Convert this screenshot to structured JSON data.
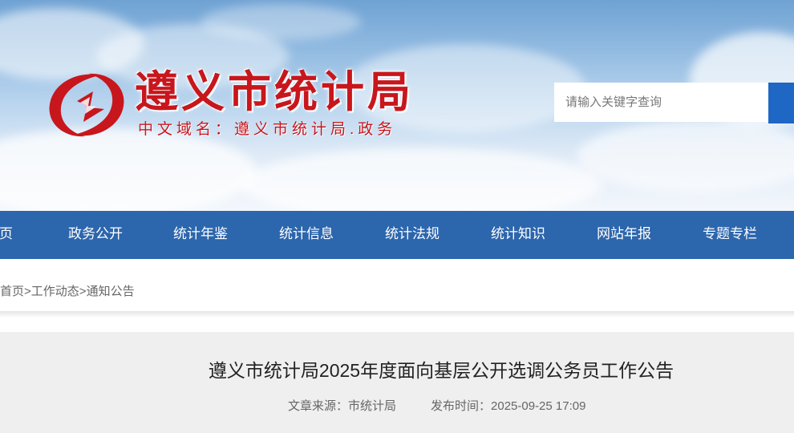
{
  "header": {
    "site_title": "遵义市统计局",
    "domain_line": "中文域名：遵义市统计局.政务",
    "search": {
      "placeholder": "请输入关键字查询"
    }
  },
  "nav": {
    "items": [
      {
        "label": "首页"
      },
      {
        "label": "政务公开"
      },
      {
        "label": "统计年鉴"
      },
      {
        "label": "统计信息"
      },
      {
        "label": "统计法规"
      },
      {
        "label": "统计知识"
      },
      {
        "label": "网站年报"
      },
      {
        "label": "专题专栏"
      }
    ]
  },
  "breadcrumb": {
    "items": [
      "首页",
      "工作动态",
      "通知公告"
    ],
    "separator": ">"
  },
  "article": {
    "title": "遵义市统计局2025年度面向基层公开选调公务员工作公告",
    "source_label": "文章来源：",
    "source_value": "市统计局",
    "time_label": "发布时间：",
    "time_value": "2025-09-25 17:09"
  },
  "colors": {
    "brand_red": "#c8161d",
    "nav_blue": "#2c66ad",
    "search_button_blue": "#1f67c4"
  },
  "icons": {
    "logo": "statistics-bureau-emblem",
    "search_button": "search-button"
  }
}
